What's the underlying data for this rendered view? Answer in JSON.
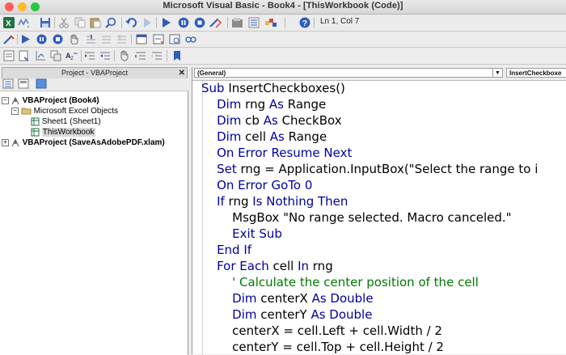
{
  "window": {
    "title": "Microsoft Visual Basic - Book4 - [ThisWorkbook (Code)]",
    "colors": {
      "close": "#fe5f57",
      "minimize": "#febc2e",
      "zoom": "#28c840"
    }
  },
  "toolbar": {
    "status": "Ln 1, Col 7",
    "icons": [
      "excel-icon",
      "insert-icon",
      "save-icon",
      "cut-icon",
      "copy-icon",
      "paste-icon",
      "find-icon",
      "undo-icon",
      "redo-icon",
      "run-icon",
      "break-icon",
      "reset-icon",
      "design-mode-icon",
      "project-explorer-icon",
      "properties-icon",
      "object-browser-icon",
      "toolbox-icon",
      "help-icon"
    ]
  },
  "project_panel": {
    "title": "Project - VBAProject",
    "tree": [
      {
        "label": "VBAProject (Book4)",
        "bold": true
      },
      {
        "label": "Microsoft Excel Objects",
        "bold": false
      },
      {
        "label": "Sheet1 (Sheet1)",
        "bold": false
      },
      {
        "label": "ThisWorkbook",
        "bold": false,
        "selected": true
      },
      {
        "label": "VBAProject (SaveAsAdobePDF.xlam)",
        "bold": true
      }
    ]
  },
  "code_window": {
    "object_combo": "(General)",
    "proc_combo": "InsertCheckboxe",
    "lines": [
      [
        [
          "kw",
          "Sub "
        ],
        [
          "id",
          "InsertCheckboxes()"
        ]
      ],
      [
        [
          "kw",
          "    Dim "
        ],
        [
          "id",
          "rng "
        ],
        [
          "kw",
          "As "
        ],
        [
          "id",
          "Range"
        ]
      ],
      [
        [
          "kw",
          "    Dim "
        ],
        [
          "id",
          "cb "
        ],
        [
          "kw",
          "As "
        ],
        [
          "id",
          "CheckBox"
        ]
      ],
      [
        [
          "kw",
          "    Dim "
        ],
        [
          "id",
          "cell "
        ],
        [
          "kw",
          "As "
        ],
        [
          "id",
          "Range"
        ]
      ],
      [
        [
          "kw",
          "    On Error Resume Next"
        ]
      ],
      [
        [
          "kw",
          "    Set "
        ],
        [
          "id",
          "rng = Application.InputBox(\"Select the range to i"
        ]
      ],
      [
        [
          "kw",
          "    On Error GoTo 0"
        ]
      ],
      [
        [
          "kw",
          "    If "
        ],
        [
          "id",
          "rng "
        ],
        [
          "kw",
          "Is Nothing Then"
        ]
      ],
      [
        [
          "id",
          "        MsgBox \"No range selected. Macro canceled.\""
        ]
      ],
      [
        [
          "kw",
          "        Exit Sub"
        ]
      ],
      [
        [
          "kw",
          "    End If"
        ]
      ],
      [
        [
          "kw",
          "    For Each "
        ],
        [
          "id",
          "cell "
        ],
        [
          "kw",
          "In "
        ],
        [
          "id",
          "rng"
        ]
      ],
      [
        [
          "cm",
          "        ' Calculate the center position of the cell"
        ]
      ],
      [
        [
          "kw",
          "        Dim "
        ],
        [
          "id",
          "centerX "
        ],
        [
          "kw",
          "As Double"
        ]
      ],
      [
        [
          "kw",
          "        Dim "
        ],
        [
          "id",
          "centerY "
        ],
        [
          "kw",
          "As Double"
        ]
      ],
      [
        [
          "id",
          "        centerX = cell.Left + cell.Width / 2"
        ]
      ],
      [
        [
          "id",
          "        centerY = cell.Top + cell.Height / 2"
        ]
      ]
    ]
  }
}
